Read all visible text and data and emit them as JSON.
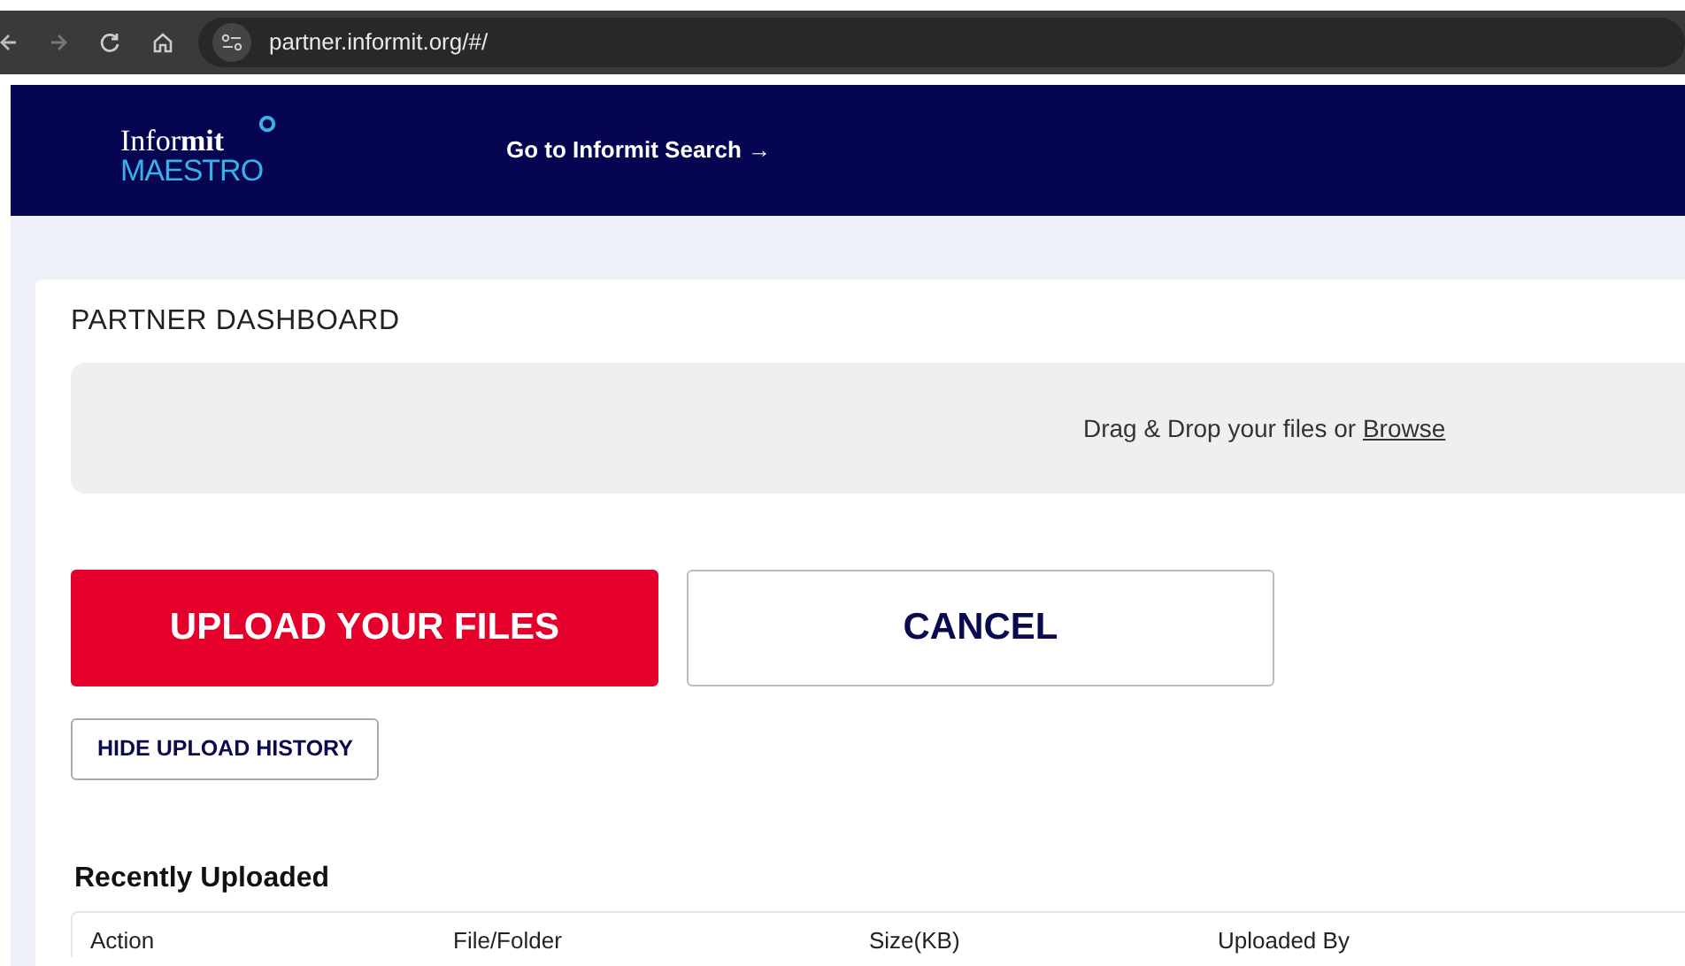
{
  "browser": {
    "url": "partner.informit.org/#/"
  },
  "header": {
    "logo_top": "Infor**mit**",
    "logo_bottom": "MAESTRO",
    "link": "Go to Informit Search →"
  },
  "dashboard": {
    "title": "PARTNER DASHBOARD",
    "dropzone": {
      "text": "Drag & Drop your files or ",
      "link": "Browse"
    },
    "buttons": [
      {
        "label": "UPLOAD YOUR FILES",
        "kind": "primary"
      },
      {
        "label": "CANCEL",
        "kind": "outline"
      }
    ],
    "history_button": "HIDE UPLOAD HISTORY",
    "recent": {
      "title": "Recently Uploaded",
      "columns": [
        "Action",
        "File/Folder",
        "Size(KB)",
        "Uploaded By"
      ]
    }
  }
}
